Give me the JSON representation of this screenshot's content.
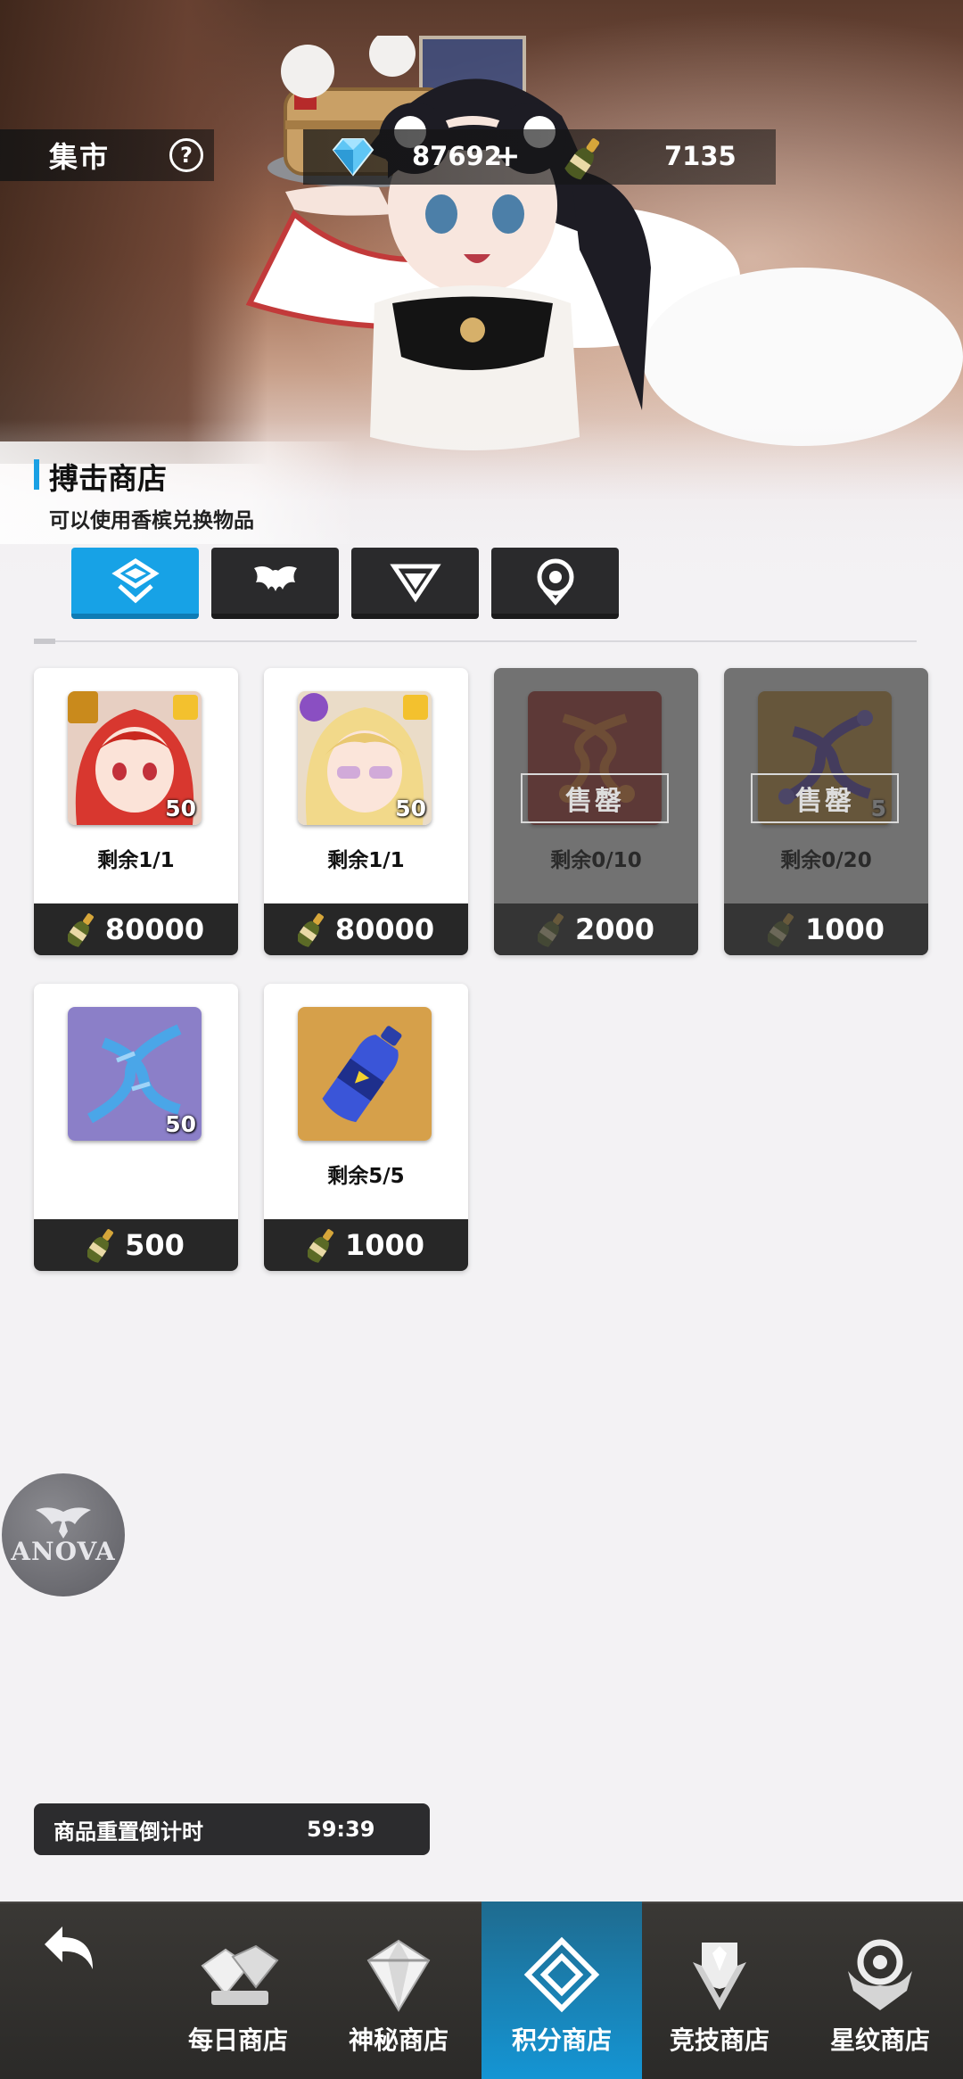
{
  "header": {
    "title": "集市",
    "help_icon": "?",
    "plus_icon": "+",
    "gem_amount": "87692",
    "bottle_amount": "7135"
  },
  "shop": {
    "name": "搏击商店",
    "description": "可以使用香槟兑换物品",
    "tabs": [
      {
        "icon": "diamond-badge-icon",
        "active": true
      },
      {
        "icon": "wings-icon",
        "active": false
      },
      {
        "icon": "chevron-emblem-icon",
        "active": false
      },
      {
        "icon": "target-emblem-icon",
        "active": false
      }
    ]
  },
  "items": [
    {
      "type": "character-portrait-red-hair",
      "qty": "50",
      "stock": "剩余1/1",
      "price": "80000",
      "sold_out": false
    },
    {
      "type": "character-portrait-blonde",
      "qty": "50",
      "stock": "剩余1/1",
      "price": "80000",
      "sold_out": false
    },
    {
      "type": "dna-red",
      "qty": "",
      "stock": "剩余0/10",
      "price": "2000",
      "sold_out": true,
      "stamp": "售罄"
    },
    {
      "type": "dna-purple",
      "qty": "5",
      "stock": "剩余0/20",
      "price": "1000",
      "sold_out": true,
      "stamp": "售罄"
    },
    {
      "type": "dna-blue",
      "qty": "50",
      "stock": "",
      "price": "500",
      "sold_out": false
    },
    {
      "type": "water-bottle",
      "qty": "",
      "stock": "剩余5/5",
      "price": "1000",
      "sold_out": false
    }
  ],
  "floating_logo": {
    "text": "ANOVA"
  },
  "timer": {
    "label": "商品重置倒计时",
    "value": "59:39"
  },
  "nav": {
    "back_icon": "back-arrow-icon",
    "items": [
      {
        "label": "每日商店",
        "icon": "gem-cluster-icon",
        "active": false
      },
      {
        "label": "神秘商店",
        "icon": "diamond-icon",
        "active": false
      },
      {
        "label": "积分商店",
        "icon": "double-diamond-icon",
        "active": true
      },
      {
        "label": "竞技商店",
        "icon": "trophy-emblem-icon",
        "active": false
      },
      {
        "label": "星纹商店",
        "icon": "star-crest-icon",
        "active": false
      }
    ]
  },
  "colors": {
    "accent": "#17a2e6",
    "card_footer": "#272727",
    "nav_bg": "#2b2a28"
  }
}
